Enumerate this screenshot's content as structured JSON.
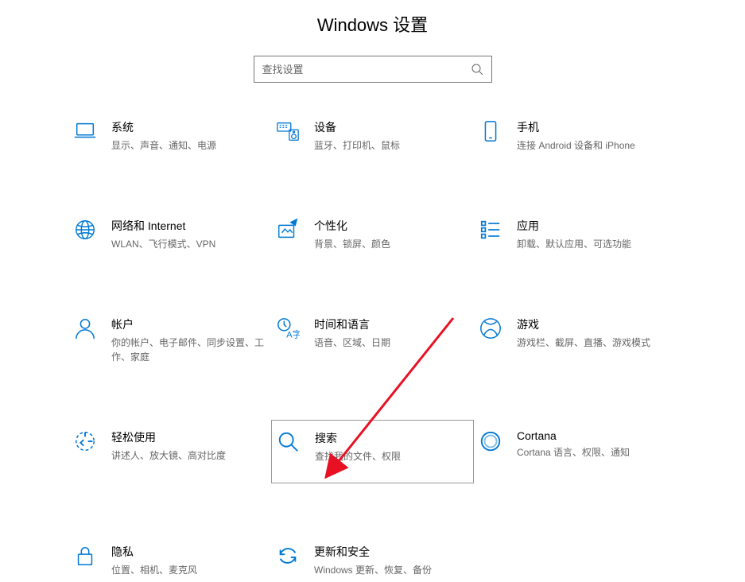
{
  "page": {
    "title": "Windows 设置"
  },
  "search": {
    "placeholder": "查找设置"
  },
  "tiles": {
    "system": {
      "title": "系统",
      "desc": "显示、声音、通知、电源"
    },
    "devices": {
      "title": "设备",
      "desc": "蓝牙、打印机、鼠标"
    },
    "phone": {
      "title": "手机",
      "desc": "连接 Android 设备和 iPhone"
    },
    "network": {
      "title": "网络和 Internet",
      "desc": "WLAN、飞行模式、VPN"
    },
    "personal": {
      "title": "个性化",
      "desc": "背景、锁屏、颜色"
    },
    "apps": {
      "title": "应用",
      "desc": "卸载、默认应用、可选功能"
    },
    "accounts": {
      "title": "帐户",
      "desc": "你的帐户、电子邮件、同步设置、工作、家庭"
    },
    "time": {
      "title": "时间和语言",
      "desc": "语音、区域、日期"
    },
    "gaming": {
      "title": "游戏",
      "desc": "游戏栏、截屏、直播、游戏模式"
    },
    "ease": {
      "title": "轻松使用",
      "desc": "讲述人、放大镜、高对比度"
    },
    "search_t": {
      "title": "搜索",
      "desc": "查找我的文件、权限"
    },
    "cortana": {
      "title": "Cortana",
      "desc": "Cortana 语言、权限、通知"
    },
    "privacy": {
      "title": "隐私",
      "desc": "位置、相机、麦克风"
    },
    "update": {
      "title": "更新和安全",
      "desc": "Windows 更新、恢复、备份"
    }
  }
}
